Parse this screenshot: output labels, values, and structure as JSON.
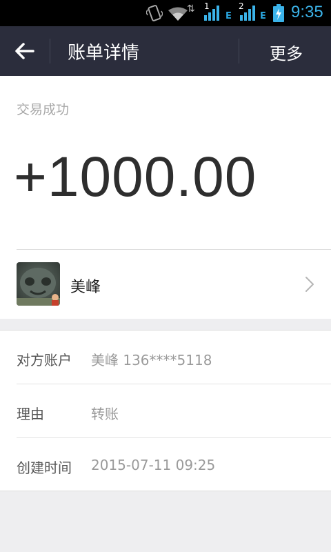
{
  "status_bar": {
    "sim1_label": "1",
    "sim2_label": "2",
    "network_type_1": "E",
    "network_type_2": "E",
    "time": "9:35",
    "icons": [
      "vibrate-icon",
      "wifi-icon",
      "data-arrows-icon",
      "signal-icon",
      "battery-charging-icon"
    ]
  },
  "titlebar": {
    "title": "账单详情",
    "more_label": "更多",
    "back_icon": "arrow-left-icon"
  },
  "transaction": {
    "status": "交易成功",
    "amount": "+1000.00"
  },
  "contact": {
    "name": "美峰",
    "chevron_icon": "chevron-right-icon"
  },
  "details": [
    {
      "label": "对方账户",
      "value": "美峰 136****5118"
    },
    {
      "label": "理由",
      "value": "转账"
    },
    {
      "label": "创建时间",
      "value": "2015-07-11 09:25"
    }
  ],
  "colors": {
    "titlebar_bg": "#2b2d3c",
    "time_accent": "#3bb3e9",
    "page_bg": "#eeeef0"
  }
}
